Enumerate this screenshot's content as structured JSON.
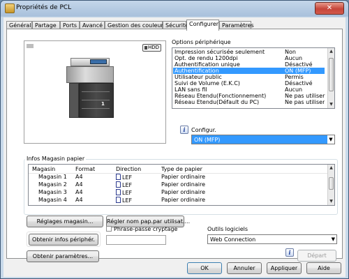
{
  "window": {
    "title": "Propriétés de PCL",
    "close_glyph": "✕"
  },
  "tabs": [
    {
      "label": "Général"
    },
    {
      "label": "Partage"
    },
    {
      "label": "Ports"
    },
    {
      "label": "Avancé"
    },
    {
      "label": "Gestion des couleurs"
    },
    {
      "label": "Sécurité"
    },
    {
      "label": "Configurer"
    },
    {
      "label": "Paramètres"
    }
  ],
  "active_tab": "Configurer",
  "preview": {
    "hdd_badge": "HDD",
    "tray_number": "1"
  },
  "device_options": {
    "title": "Options périphérique",
    "rows": [
      {
        "name": "Impression sécurisée seulement",
        "value": "Non"
      },
      {
        "name": "Opt. de rendu 1200dpi",
        "value": "Aucun"
      },
      {
        "name": "Authentification unique",
        "value": "Désactivé"
      },
      {
        "name": "Authentification",
        "value": "ON (MFP)",
        "selected": true
      },
      {
        "name": "Utilisateur public",
        "value": "Permis"
      },
      {
        "name": "Suivi de Volume (E.K.C)",
        "value": "Désactivé"
      },
      {
        "name": "LAN sans fil",
        "value": "Aucun"
      },
      {
        "name": "Réseau Etendu(Fonctionnement)",
        "value": "Ne pas utiliser"
      },
      {
        "name": "Réseau Etendu(Défault du PC)",
        "value": "Ne pas utiliser"
      }
    ],
    "configure_label": "Configur.",
    "configure_value": "ON (MFP)"
  },
  "paper_info": {
    "title": "Infos Magasin papier",
    "columns": [
      "Magasin",
      "Format",
      "Direction",
      "Type de papier"
    ],
    "rows": [
      {
        "tray": "Magasin 1",
        "format": "A4",
        "direction": "LEF",
        "type": "Papier ordinaire"
      },
      {
        "tray": "Magasin 2",
        "format": "A4",
        "direction": "LEF",
        "type": "Papier ordinaire"
      },
      {
        "tray": "Magasin 3",
        "format": "A4",
        "direction": "LEF",
        "type": "Papier ordinaire"
      },
      {
        "tray": "Magasin 4",
        "format": "A4",
        "direction": "LEF",
        "type": "Papier ordinaire"
      }
    ]
  },
  "buttons": {
    "tray_settings": "Réglages magasin...",
    "paper_by_user": "Régler nom pap.par utilisat....",
    "get_device_info": "Obtenir infos périphér.",
    "get_settings": "Obtenir paramètres...",
    "start": "Départ",
    "ok": "OK",
    "cancel": "Annuler",
    "apply": "Appliquer",
    "help": "Aide"
  },
  "passphrase": {
    "label": "Phrase-passe cryptage",
    "checked": false,
    "value": ""
  },
  "software_tools": {
    "label": "Outils logiciels",
    "selected": "Web Connection"
  }
}
